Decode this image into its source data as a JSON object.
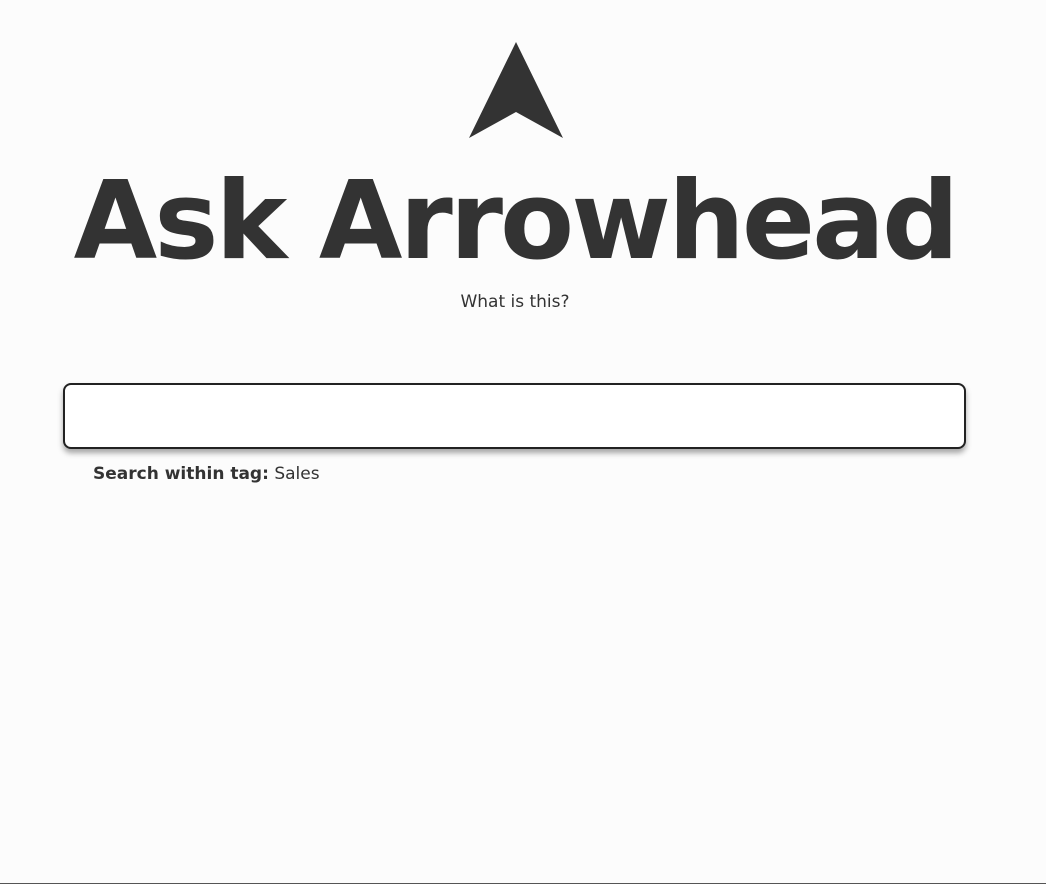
{
  "header": {
    "logo_icon": "arrowhead-icon",
    "title": "Ask Arrowhead",
    "about_link": "What is this?"
  },
  "search": {
    "value": "",
    "placeholder": "",
    "tag_label": "Search within tag:",
    "tag_value": "Sales"
  },
  "colors": {
    "text": "#333333",
    "background": "#fcfcfc",
    "border": "#222222"
  }
}
